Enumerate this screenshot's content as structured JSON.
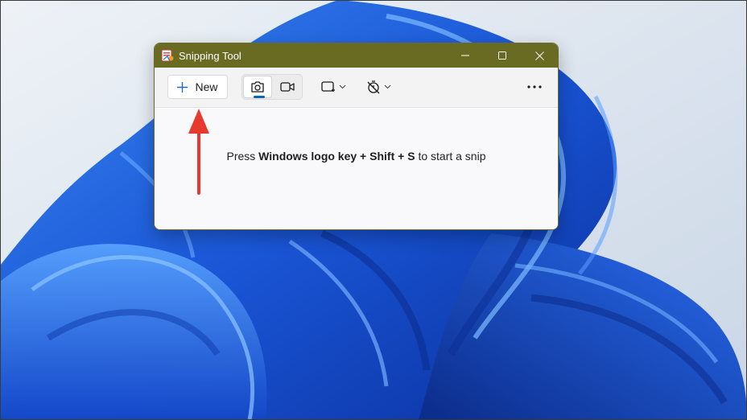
{
  "window": {
    "title": "Snipping Tool",
    "controls": {
      "minimize": "minimize-icon",
      "maximize": "maximize-icon",
      "close": "close-icon"
    }
  },
  "toolbar": {
    "new_label": "New",
    "modes": [
      {
        "name": "snip-mode",
        "icon": "camera-icon",
        "active": true
      },
      {
        "name": "record-mode",
        "icon": "video-icon",
        "active": false
      }
    ],
    "shape_dropdown_icon": "rectangle-snip-icon",
    "delay_dropdown_icon": "timer-off-icon",
    "more_icon": "more-icon"
  },
  "content": {
    "hint_prefix": "Press ",
    "hint_key1": "Windows logo key",
    "hint_plus1": " + ",
    "hint_key2": "Shift",
    "hint_plus2": " + ",
    "hint_key3": "S",
    "hint_suffix": " to start a snip"
  },
  "annotation": {
    "arrow_color": "#e8392f"
  },
  "colors": {
    "titlebar": "#696b23",
    "accent": "#0067c0",
    "wallpaper_blue": "#1f5fe0"
  }
}
